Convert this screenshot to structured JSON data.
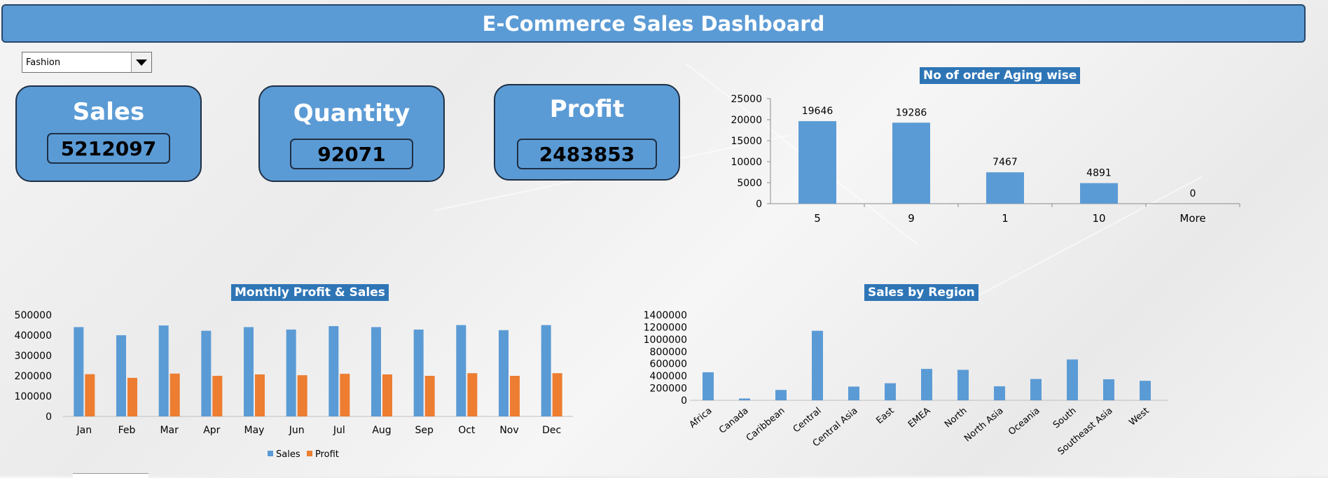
{
  "header": {
    "title": "E-Commerce Sales Dashboard"
  },
  "slicer": {
    "value": "Fashion"
  },
  "kpis": {
    "sales": {
      "label": "Sales",
      "value": "5212097"
    },
    "quantity": {
      "label": "Quantity",
      "value": "92071"
    },
    "profit": {
      "label": "Profit",
      "value": "2483853"
    }
  },
  "colors": {
    "header": "#5b9bd5",
    "bar_blue": "#5b9bd5",
    "bar_orange": "#ed7d31",
    "title_bg": "#2e75b6"
  },
  "chart_data": [
    {
      "type": "bar",
      "title": "No  of order Aging wise",
      "categories": [
        "5",
        "9",
        "1",
        "10",
        "More"
      ],
      "values": [
        19646,
        19286,
        7467,
        4891,
        0
      ],
      "ylim": [
        0,
        25000
      ],
      "yticks": [
        "0",
        "5000",
        "10000",
        "15000",
        "20000",
        "25000"
      ],
      "data_labels": [
        "19646",
        "19286",
        "7467",
        "4891",
        "0"
      ],
      "grid": false
    },
    {
      "type": "bar",
      "title": "Monthly Profit & Sales",
      "categories": [
        "Jan",
        "Feb",
        "Mar",
        "Apr",
        "May",
        "Jun",
        "Jul",
        "Aug",
        "Sep",
        "Oct",
        "Nov",
        "Dec"
      ],
      "series": [
        {
          "name": "Sales",
          "values": [
            440000,
            400000,
            448000,
            422000,
            440000,
            428000,
            445000,
            440000,
            428000,
            450000,
            425000,
            450000
          ]
        },
        {
          "name": "Profit",
          "values": [
            208000,
            190000,
            211000,
            200000,
            207000,
            203000,
            210000,
            207000,
            200000,
            213000,
            200000,
            213000
          ]
        }
      ],
      "ylim": [
        0,
        500000
      ],
      "yticks": [
        "0",
        "100000",
        "200000",
        "300000",
        "400000",
        "500000"
      ],
      "legend": "bottom",
      "grid": false
    },
    {
      "type": "bar",
      "title": "Sales by Region",
      "categories": [
        "Africa",
        "Canada",
        "Caribbean",
        "Central",
        "Central Asia",
        "East",
        "EMEA",
        "North",
        "North Asia",
        "Oceania",
        "South",
        "Southeast Asia",
        "West"
      ],
      "values": [
        460000,
        30000,
        170000,
        1140000,
        225000,
        280000,
        515000,
        500000,
        230000,
        350000,
        670000,
        345000,
        320000
      ],
      "ylim": [
        0,
        1400000
      ],
      "yticks": [
        "0",
        "200000",
        "400000",
        "600000",
        "800000",
        "1000000",
        "1200000",
        "1400000"
      ],
      "grid": false
    }
  ]
}
